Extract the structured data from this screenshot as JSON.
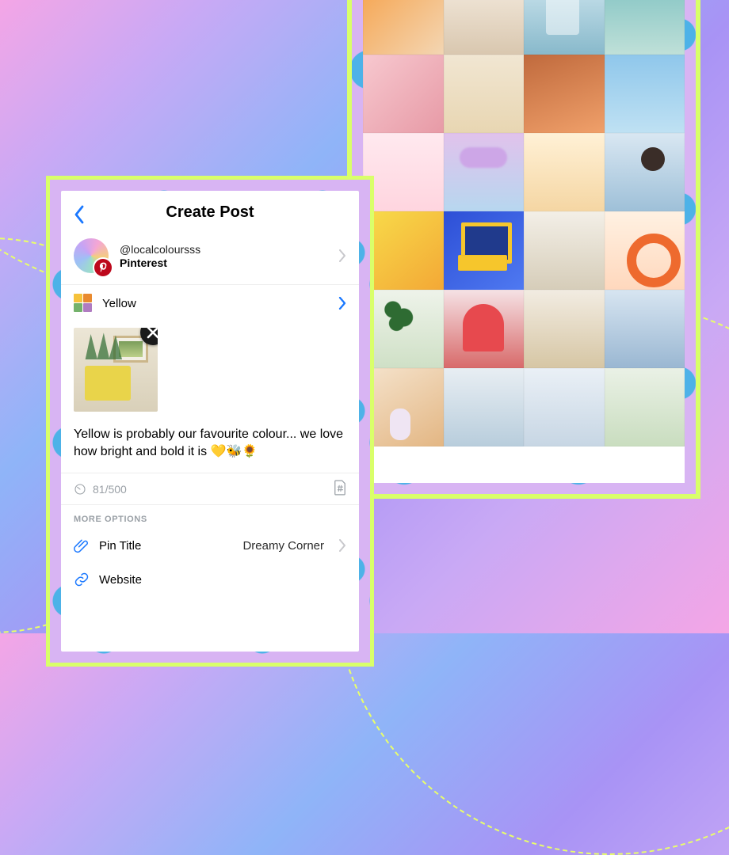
{
  "header": {
    "title": "Create Post"
  },
  "account": {
    "handle": "@localcoloursss",
    "platform": "Pinterest"
  },
  "board": {
    "name": "Yellow"
  },
  "caption": {
    "text": "Yellow is probably our favourite colour... we love how bright and bold it is 💛🐝🌻"
  },
  "meta": {
    "char_count": "81/500"
  },
  "more_options": {
    "header": "MORE OPTIONS",
    "pin_title": {
      "label": "Pin Title",
      "value": "Dreamy Corner"
    },
    "website": {
      "label": "Website",
      "value": ""
    }
  },
  "icons": {
    "back": "chevron-left-icon",
    "account_chevron": "chevron-right-icon",
    "board_chevron": "chevron-right-icon",
    "remove_media": "close-icon",
    "char_counter": "gauge-icon",
    "hashtag_tool": "hashtag-doc-icon",
    "pin_title": "paperclip-icon",
    "website": "link-icon",
    "pinterest_badge": "pinterest-icon"
  },
  "colors": {
    "accent_blue": "#1a78ff",
    "pinterest_red": "#bd081c",
    "muted": "#9aa0a6",
    "frame_border": "#d9ff6a"
  },
  "grid_tiles": [
    "orange-drinks",
    "interior",
    "ice-blocks",
    "flower-teal",
    "pink-room",
    "oranges-plate",
    "woman-stairs",
    "bouquet-sky",
    "candle-pink",
    "lavender-clouds",
    "flowers-vase",
    "portrait-sky",
    "yellow-flowers",
    "yellow-window",
    "living-room",
    "orange-vase",
    "plant-books",
    "red-arch",
    "wood-chair",
    "street-pose",
    "lavender-shadow",
    "coffee-cups",
    "cakes-box",
    "green-drinks"
  ]
}
